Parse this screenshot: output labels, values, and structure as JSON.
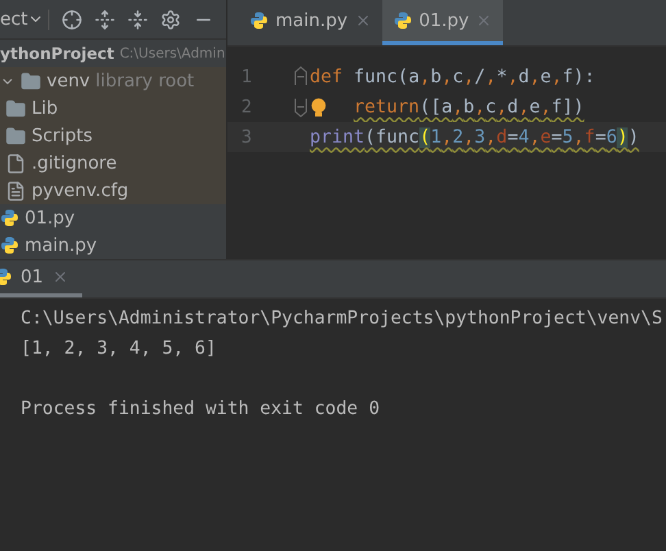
{
  "project_panel": {
    "view_selector": "ect",
    "tree": [
      {
        "label": "ythonProject",
        "path": "C:\\Users\\Admin",
        "kind": "root",
        "children": [
          {
            "label": "venv",
            "note": "library root",
            "kind": "library",
            "expanded": true,
            "children": [
              {
                "label": "Lib",
                "kind": "folder"
              },
              {
                "label": "Scripts",
                "kind": "folder"
              },
              {
                "label": ".gitignore",
                "kind": "ignored"
              },
              {
                "label": "pyvenv.cfg",
                "kind": "text"
              }
            ]
          },
          {
            "label": "01.py",
            "kind": "python"
          },
          {
            "label": "main.py",
            "kind": "python"
          }
        ]
      }
    ]
  },
  "editor": {
    "tabs": [
      {
        "label": "main.py",
        "selected": false
      },
      {
        "label": "01.py",
        "selected": true
      }
    ],
    "lines": [
      {
        "number": "1",
        "fold_start": true,
        "fold_end": false,
        "bulb": false,
        "indented": false,
        "current": false,
        "warning": false,
        "tokens": [
          {
            "text": "def",
            "kind": "keyword"
          },
          {
            "text": " func(a",
            "kind": "plain"
          },
          {
            "text": ",",
            "kind": "comma"
          },
          {
            "text": "b",
            "kind": "plain"
          },
          {
            "text": ",",
            "kind": "comma"
          },
          {
            "text": "c",
            "kind": "plain"
          },
          {
            "text": ",",
            "kind": "comma"
          },
          {
            "text": "/",
            "kind": "plain"
          },
          {
            "text": ",",
            "kind": "comma"
          },
          {
            "text": "*",
            "kind": "plain"
          },
          {
            "text": ",",
            "kind": "comma"
          },
          {
            "text": "d",
            "kind": "plain"
          },
          {
            "text": ",",
            "kind": "comma"
          },
          {
            "text": "e",
            "kind": "plain"
          },
          {
            "text": ",",
            "kind": "comma"
          },
          {
            "text": "f):",
            "kind": "plain"
          }
        ]
      },
      {
        "number": "2",
        "fold_start": false,
        "fold_end": true,
        "bulb": true,
        "indented": true,
        "current": false,
        "warning": true,
        "tokens": [
          {
            "text": "return",
            "kind": "keyword"
          },
          {
            "text": "([a",
            "kind": "plain"
          },
          {
            "text": ",",
            "kind": "comma"
          },
          {
            "text": "b",
            "kind": "plain"
          },
          {
            "text": ",",
            "kind": "comma"
          },
          {
            "text": "c",
            "kind": "plain"
          },
          {
            "text": ",",
            "kind": "comma"
          },
          {
            "text": "d",
            "kind": "plain"
          },
          {
            "text": ",",
            "kind": "comma"
          },
          {
            "text": "e",
            "kind": "plain"
          },
          {
            "text": ",",
            "kind": "comma"
          },
          {
            "text": "f])",
            "kind": "plain"
          }
        ]
      },
      {
        "number": "3",
        "fold_start": false,
        "fold_end": false,
        "bulb": false,
        "indented": false,
        "current": true,
        "warning": true,
        "tokens": [
          {
            "text": "print",
            "kind": "builtin"
          },
          {
            "text": "(func",
            "kind": "plain"
          },
          {
            "text": "(",
            "kind": "match"
          },
          {
            "text": "1",
            "kind": "number"
          },
          {
            "text": ",",
            "kind": "comma"
          },
          {
            "text": "2",
            "kind": "number"
          },
          {
            "text": ",",
            "kind": "comma"
          },
          {
            "text": "3",
            "kind": "number"
          },
          {
            "text": ",",
            "kind": "comma"
          },
          {
            "text": "d",
            "kind": "param"
          },
          {
            "text": "=",
            "kind": "plain"
          },
          {
            "text": "4",
            "kind": "number"
          },
          {
            "text": ",",
            "kind": "comma"
          },
          {
            "text": "e",
            "kind": "param"
          },
          {
            "text": "=",
            "kind": "plain"
          },
          {
            "text": "5",
            "kind": "number"
          },
          {
            "text": ",",
            "kind": "comma"
          },
          {
            "text": "f",
            "kind": "param"
          },
          {
            "text": "=",
            "kind": "plain"
          },
          {
            "text": "6",
            "kind": "number"
          },
          {
            "text": ")",
            "kind": "match"
          },
          {
            "text": ")",
            "kind": "plain"
          }
        ]
      }
    ]
  },
  "run_panel": {
    "tabs": [
      {
        "label": "01",
        "selected": true
      }
    ],
    "console": [
      {
        "text": "C:\\Users\\Administrator\\PycharmProjects\\pythonProject\\venv\\S",
        "kind": "output"
      },
      {
        "text": "[1, 2, 3, 4, 5, 6]",
        "kind": "output"
      },
      {
        "text": "Process finished with exit code 0",
        "kind": "status"
      }
    ]
  }
}
